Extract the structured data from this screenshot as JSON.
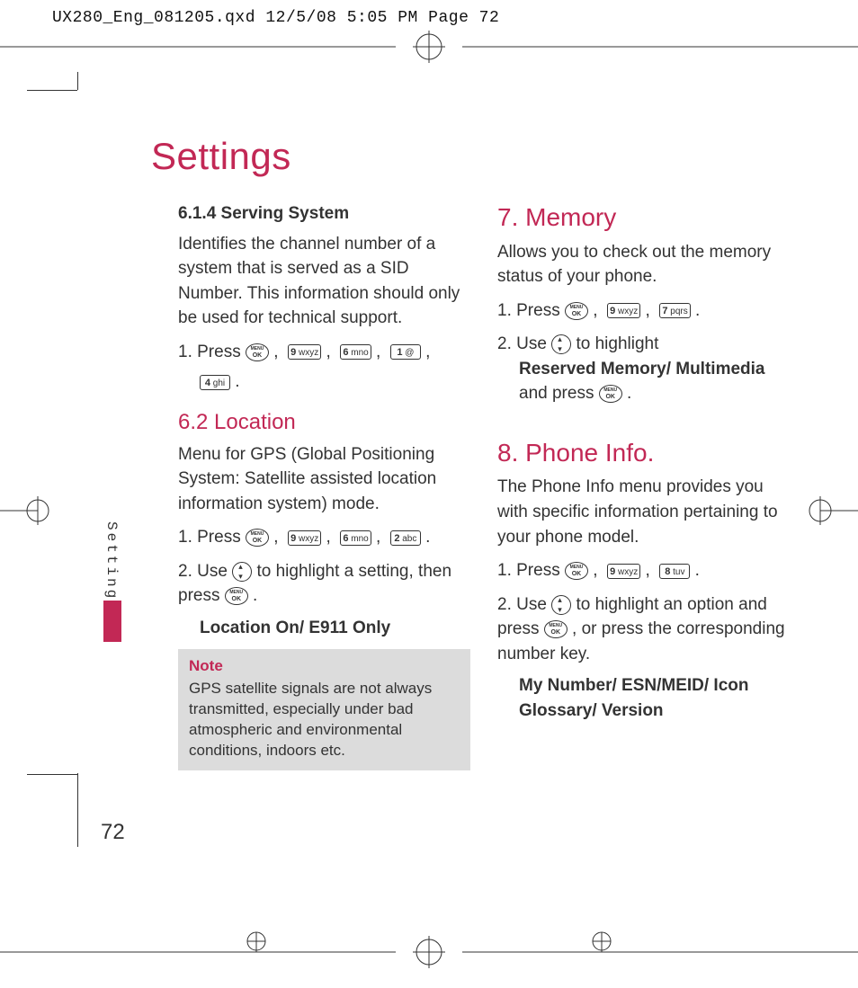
{
  "header": "UX280_Eng_081205.qxd  12/5/08  5:05 PM  Page 72",
  "page_title": "Settings",
  "side_tab": "Settings",
  "page_number": "72",
  "keys": {
    "ok": "MENU OK",
    "nav": "nav",
    "1": "1 @",
    "2": "2 abc",
    "4": "4 ghi",
    "6": "6 mno",
    "7": "7 pqrs",
    "8": "8 tuv",
    "9": "9 wxyz"
  },
  "left": {
    "s614_title": "6.1.4 Serving System",
    "s614_body": "Identifies the channel number of a system that is served as a SID Number. This information should only be used for technical support.",
    "s614_step1_a": "1. Press ",
    "s62_title": "6.2 Location",
    "s62_body": "Menu for GPS (Global Positioning System: Satellite assisted location information system) mode.",
    "s62_step1_a": "1. Press ",
    "s62_step2_a": "2. Use ",
    "s62_step2_b": " to highlight a setting, then press ",
    "s62_opts": "Location On/ E911 Only",
    "note_title": "Note",
    "note_body": "GPS satellite signals are not always transmitted, especially under bad atmospheric and environmental conditions, indoors etc."
  },
  "right": {
    "s7_title": "7. Memory",
    "s7_body": "Allows you to check out the memory status of your phone.",
    "s7_step1_a": "1. Press ",
    "s7_step2_a": "2. Use ",
    "s7_step2_b": " to highlight ",
    "s7_step2_bold": "Reserved Memory/ Multimedia",
    "s7_step2_c": " and press ",
    "s8_title": "8. Phone Info.",
    "s8_body": "The Phone Info menu provides you with specific information pertaining to your phone model.",
    "s8_step1_a": "1. Press ",
    "s8_step2_a": "2. Use ",
    "s8_step2_b": " to highlight an option and press ",
    "s8_step2_c": " , or press the corresponding number key.",
    "s8_opts": "My Number/ ESN/MEID/ Icon Glossary/ Version"
  }
}
